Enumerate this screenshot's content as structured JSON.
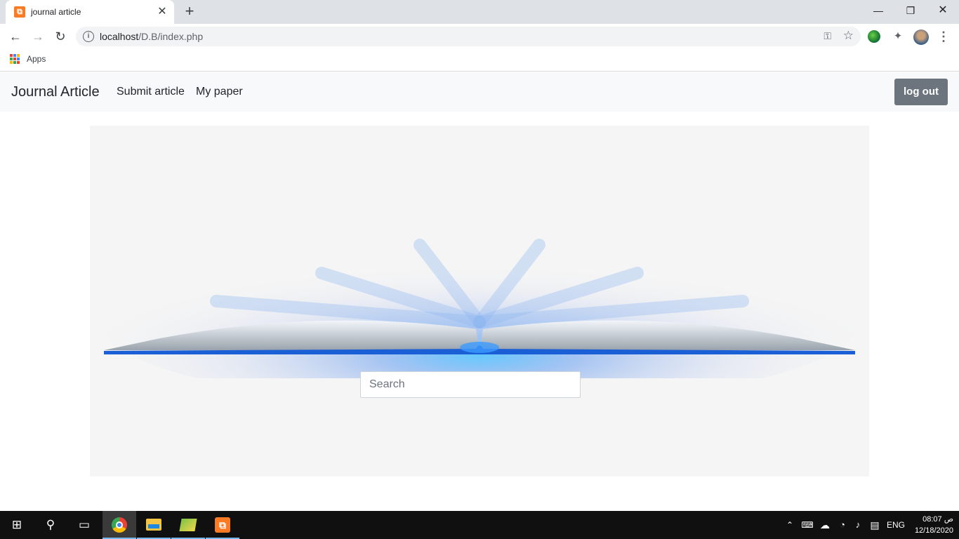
{
  "browser": {
    "tab_title": "journal article",
    "tab_favicon": "xampp-icon",
    "url_host": "localhost",
    "url_path": "/D.B/index.php",
    "bookmarks": [
      {
        "label": "Apps",
        "icon": "apps-grid-icon"
      }
    ]
  },
  "navbar": {
    "brand": "Journal Article",
    "links": [
      "Submit article",
      "My paper"
    ],
    "logout_label": "log out"
  },
  "hero": {
    "image": "open-book-glowing-image",
    "search_placeholder": "Search"
  },
  "taskbar": {
    "apps": [
      "windows-start-icon",
      "search-icon",
      "task-view-icon",
      "chrome-icon",
      "file-explorer-icon",
      "maps-icon",
      "xampp-icon"
    ],
    "language": "ENG",
    "time": "08:07 ص",
    "date": "12/18/2020"
  },
  "colors": {
    "navbar_bg": "#f8f9fa",
    "logout_bg": "#6c757d",
    "hero_bg": "#f5f5f5",
    "book_glow": "#4aa8ff"
  }
}
